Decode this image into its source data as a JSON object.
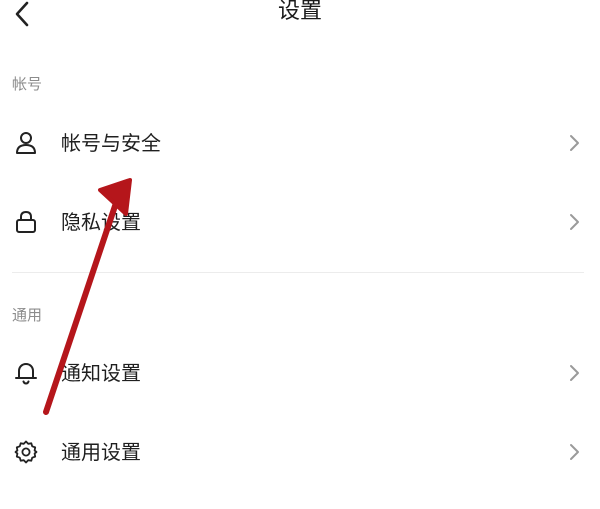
{
  "header": {
    "title": "设置",
    "back_icon": "chevron-left-icon"
  },
  "sections": [
    {
      "title": "帐号",
      "items": [
        {
          "label": "帐号与安全",
          "icon": "user-icon"
        },
        {
          "label": "隐私设置",
          "icon": "lock-icon"
        }
      ]
    },
    {
      "title": "通用",
      "items": [
        {
          "label": "通知设置",
          "icon": "bell-icon"
        },
        {
          "label": "通用设置",
          "icon": "gear-icon"
        }
      ]
    }
  ],
  "colors": {
    "annotation_arrow": "#b5161b",
    "section_header": "#8c8c8c",
    "divider": "#ececec",
    "chevron": "#9a9a9a"
  }
}
